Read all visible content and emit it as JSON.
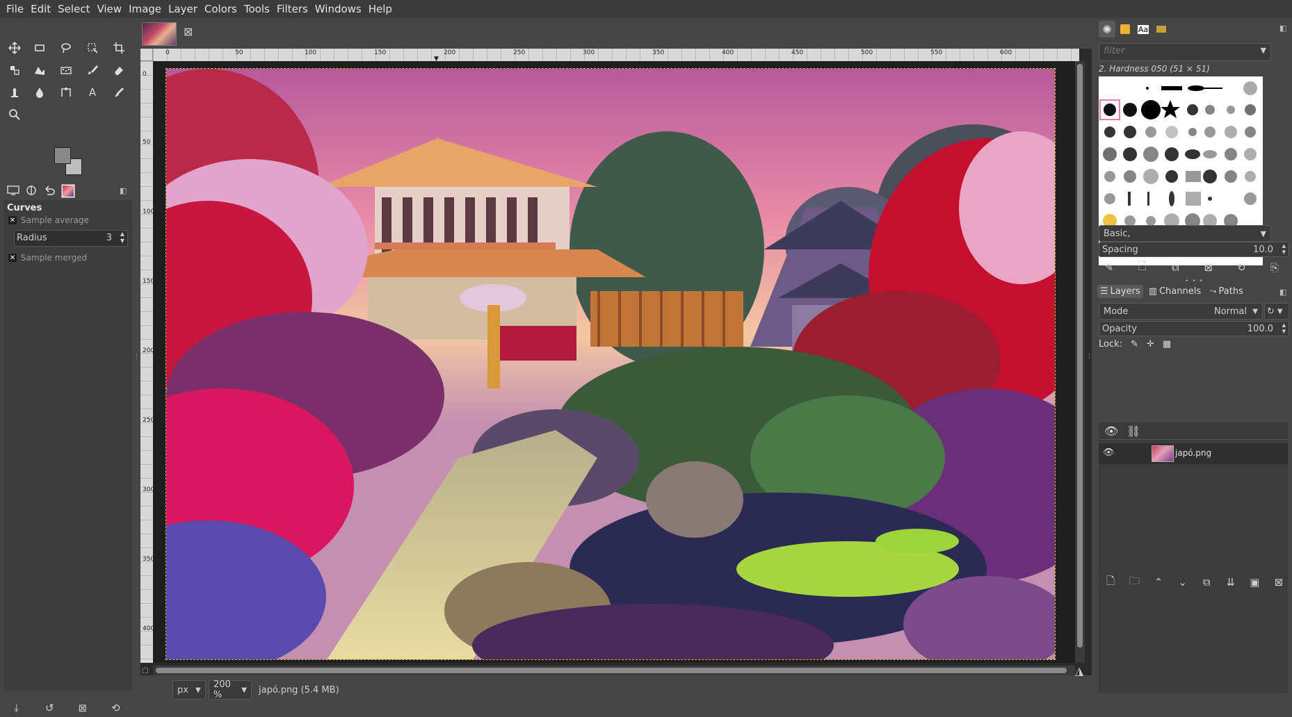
{
  "menubar": {
    "items": [
      "File",
      "Edit",
      "Select",
      "View",
      "Image",
      "Layer",
      "Colors",
      "Tools",
      "Filters",
      "Windows",
      "Help"
    ]
  },
  "tool_options": {
    "title": "Curves",
    "sample_average_label": "Sample average",
    "radius_label": "Radius",
    "radius_value": "3",
    "sample_merged_label": "Sample merged"
  },
  "ruler": {
    "h_ticks": [
      "0",
      "50",
      "100",
      "150",
      "200",
      "250",
      "300",
      "350",
      "400",
      "450",
      "500",
      "550",
      "600"
    ],
    "v_ticks": [
      "0",
      "50",
      "100",
      "150",
      "200",
      "250",
      "300",
      "350",
      "400"
    ]
  },
  "statusbar": {
    "unit": "px",
    "zoom": "200 %",
    "file_info": "japó.png (5.4 MB)"
  },
  "brushes": {
    "filter_placeholder": "filter",
    "selected_brush": "2. Hardness 050 (51 × 51)",
    "preset": "Basic,",
    "spacing_label": "Spacing",
    "spacing_value": "10.0"
  },
  "layers": {
    "tabs": [
      "Layers",
      "Channels",
      "Paths"
    ],
    "mode_label": "Mode",
    "mode_value": "Normal",
    "opacity_label": "Opacity",
    "opacity_value": "100.0",
    "lock_label": "Lock:",
    "items": [
      {
        "name": "japó.png"
      }
    ]
  },
  "colors": {
    "accent": "#f2c200",
    "fg": "#8a8a8a",
    "bg": "#bdbdbd"
  }
}
